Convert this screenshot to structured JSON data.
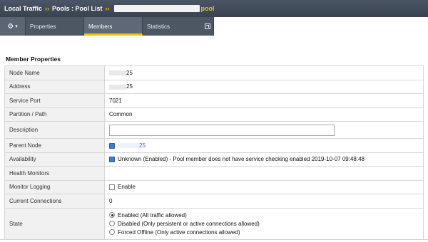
{
  "breadcrumb": {
    "items": [
      "Local Traffic",
      "Pools : Pool List"
    ],
    "separator": "››",
    "pool_suffix": "pool"
  },
  "tabs": {
    "gear": "gear-icon",
    "items": [
      {
        "label": "Properties",
        "selected": false
      },
      {
        "label": "Members",
        "selected": true
      },
      {
        "label": "Statistics",
        "selected": false
      }
    ]
  },
  "section": {
    "title": "Member Properties"
  },
  "properties": {
    "node_name": {
      "label": "Node Name",
      "value": "25"
    },
    "address": {
      "label": "Address",
      "value": "25"
    },
    "service_port": {
      "label": "Service Port",
      "value": "7021"
    },
    "partition": {
      "label": "Partition / Path",
      "value": "Common"
    },
    "description": {
      "label": "Description",
      "value": ""
    },
    "parent_node": {
      "label": "Parent Node",
      "value": "25"
    },
    "availability": {
      "label": "Availability",
      "value": "Unknown (Enabled) - Pool member does not have service checking enabled 2019-10-07 09:48:48"
    },
    "health_monitors": {
      "label": "Health Monitors",
      "value": ""
    },
    "monitor_logging": {
      "label": "Monitor Logging",
      "value": "Enable",
      "checked": false
    },
    "current_connections": {
      "label": "Current Connections",
      "value": "0"
    },
    "state": {
      "label": "State",
      "options": [
        {
          "label": "Enabled (All traffic allowed)",
          "checked": true
        },
        {
          "label": "Disabled (Only persistent or active connections allowed)",
          "checked": false
        },
        {
          "label": "Forced Offline (Only active connections allowed)",
          "checked": false
        }
      ]
    }
  },
  "colors": {
    "accent": "#f2c200",
    "header_bg": "#4a5567",
    "link": "#2a5fd6"
  }
}
